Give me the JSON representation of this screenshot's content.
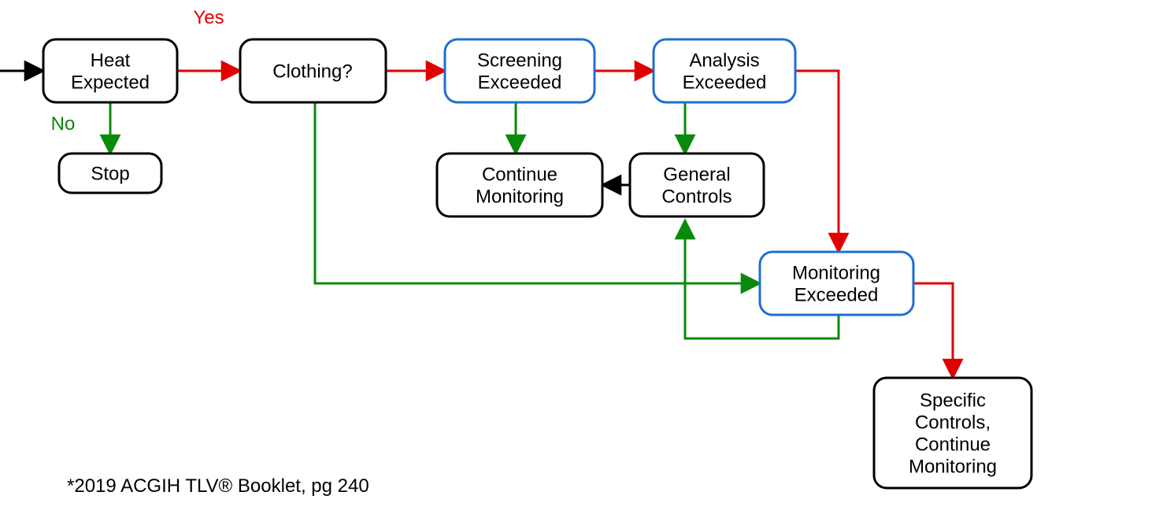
{
  "colors": {
    "red": "#e10000",
    "green": "#0a8a0a",
    "black": "#000000",
    "blue": "#1f6fd1"
  },
  "labels": {
    "yes": "Yes",
    "no": "No"
  },
  "nodes": {
    "heat": {
      "line1": "Heat",
      "line2": "Expected"
    },
    "stop": {
      "line1": "Stop"
    },
    "clothing": {
      "line1": "Clothing?"
    },
    "screening": {
      "line1": "Screening",
      "line2": "Exceeded"
    },
    "analysis": {
      "line1": "Analysis",
      "line2": "Exceeded"
    },
    "continue": {
      "line1": "Continue",
      "line2": "Monitoring"
    },
    "general": {
      "line1": "General",
      "line2": "Controls"
    },
    "monitor": {
      "line1": "Monitoring",
      "line2": "Exceeded"
    },
    "specific": {
      "line1": "Specific",
      "line2": "Controls,",
      "line3": "Continue",
      "line4": "Monitoring"
    }
  },
  "footnote": "*2019 ACGIH TLV® Booklet, pg 240"
}
